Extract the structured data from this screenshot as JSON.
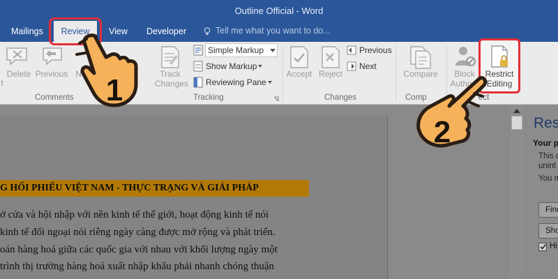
{
  "window": {
    "title": "Outline Official - Word"
  },
  "tabs": [
    {
      "label": "Mailings"
    },
    {
      "label": "Review"
    },
    {
      "label": "View"
    },
    {
      "label": "Developer"
    }
  ],
  "tell_me": {
    "placeholder": "Tell me what you want to do..."
  },
  "ribbon": {
    "comments": {
      "group_label": "Comments",
      "new_partial": "t",
      "delete": "Delete",
      "previous": "Previous",
      "next_partial": "Ne"
    },
    "tracking": {
      "group_label": "Tracking",
      "track_changes_line1": "Track",
      "track_changes_line2": "Changes",
      "markup_dropdown": "Simple Markup",
      "show_markup": "Show Markup",
      "reviewing_pane": "Reviewing Pane"
    },
    "changes": {
      "group_label": "Changes",
      "accept": "Accept",
      "reject": "Reject",
      "previous": "Previous",
      "next": "Next"
    },
    "compare": {
      "group_label_partial": "Comp",
      "compare": "Compare"
    },
    "protect": {
      "group_label_partial": "ect",
      "block_line1": "Block",
      "block_line2": "Authors",
      "restrict_line1": "Restrict",
      "restrict_line2": "Editing"
    }
  },
  "document": {
    "heading": "G HỐI PHIẾU VIỆT NAM - THỰC TRẠNG VÀ GIẢI PHÁP",
    "lines": [
      "ở cửa và hội nhập với nền kinh tế thế giới, hoạt động kinh tế nói",
      "kinh tế đối ngoại nói riêng ngày càng được mở rộng và phát triển.",
      "oán hàng hoá giữa các quốc gia với nhau với khối lượng ngày một",
      "trình thị trường hàng hoá xuất nhập khẩu phải nhanh chóng thuận"
    ]
  },
  "pane": {
    "title_partial": "Rest",
    "heading_partial": "Your p",
    "text_lines": [
      "This d",
      "unint",
      "You m"
    ],
    "find_button": "Find",
    "show_button": "Sho",
    "checkbox_label": "Hi"
  },
  "callouts": {
    "step1": "1",
    "step2": "2"
  },
  "colors": {
    "title_bar": "#2b579a",
    "highlight_border": "#e22f38",
    "heading_highlight": "#b37a07",
    "hand_fill": "#f5b25a",
    "hand_outline": "#2a1e14"
  }
}
